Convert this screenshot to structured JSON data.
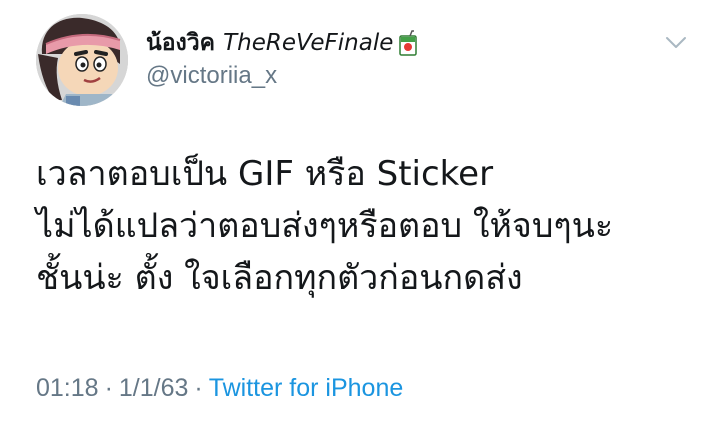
{
  "user": {
    "display_name": "น้องวิค",
    "display_name_extra": "TheReVeFinale",
    "name_emoji_icon": "juice-box-icon",
    "handle": "@victoriia_x",
    "avatar_icon": "cartoon-character-avatar"
  },
  "tweet": {
    "lines": [
      "เวลาตอบเป็น GIF หรือ Sticker",
      "ไม่ได้แปลว่าตอบส่งๆหรือตอบ ให้จบๆนะ",
      "ชั้นน่ะ ตั้ง ใจเลือกทุกตัวก่อนกดส่ง"
    ]
  },
  "meta": {
    "time": "01:18",
    "separator": "·",
    "date": "1/1/63",
    "source": "Twitter for iPhone"
  },
  "menu": {
    "icon": "chevron-down-icon"
  },
  "colors": {
    "text": "#14171a",
    "secondary": "#657786",
    "link": "#1b95e0"
  }
}
